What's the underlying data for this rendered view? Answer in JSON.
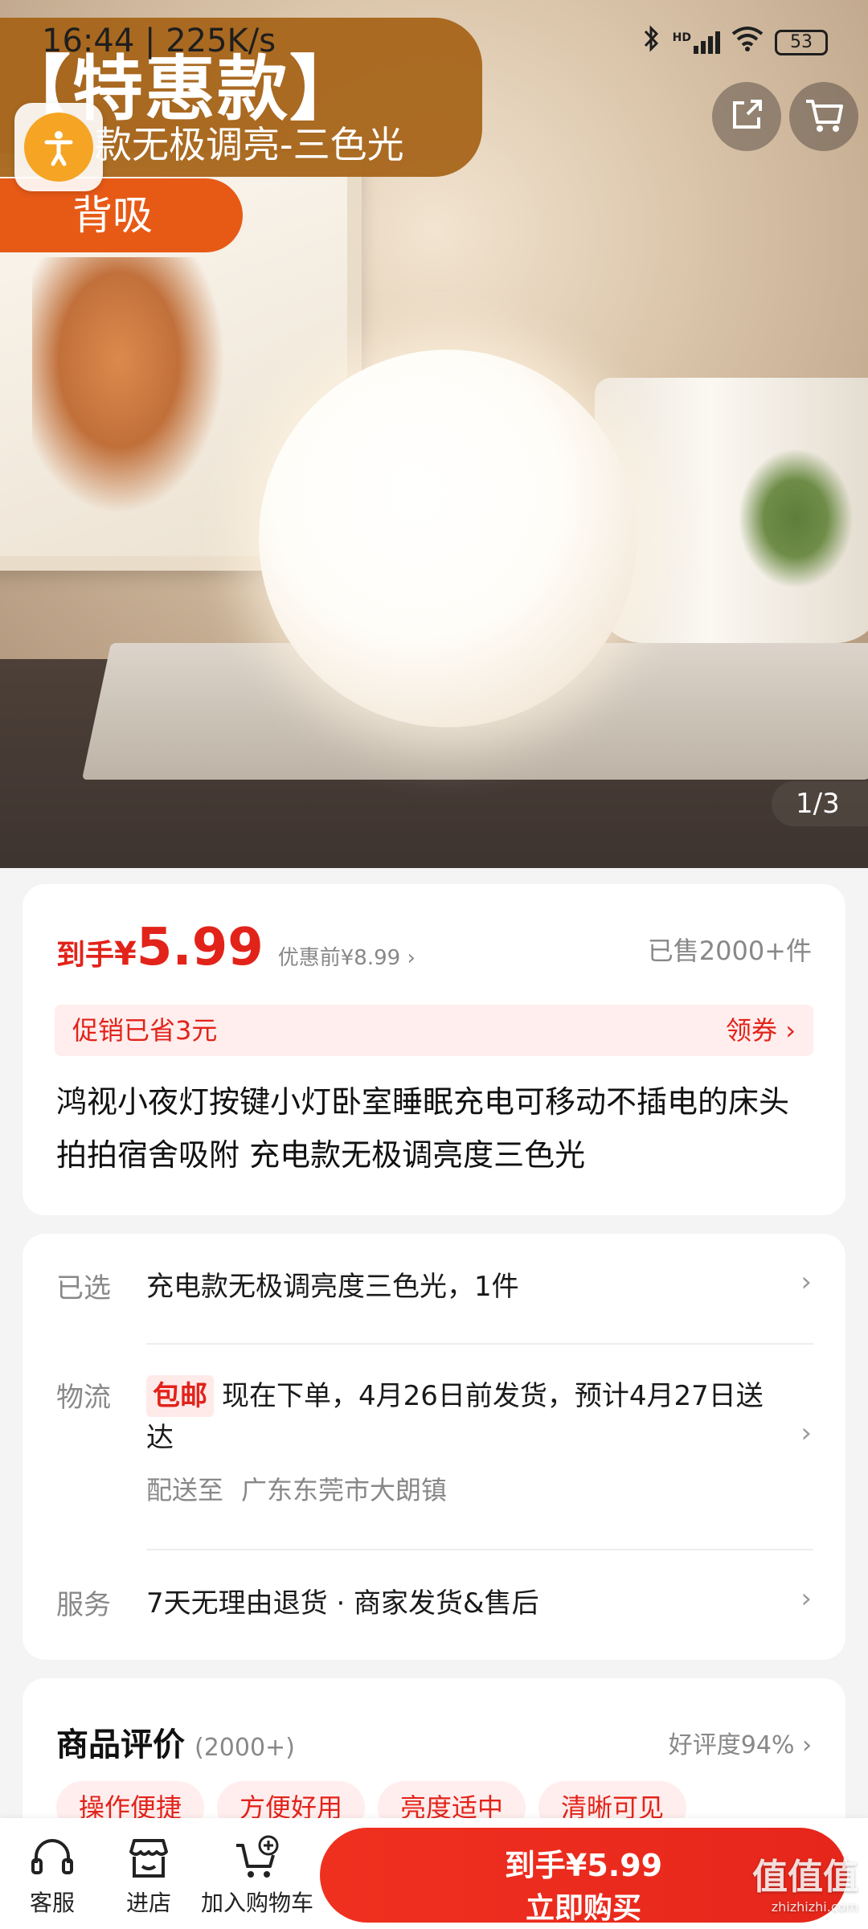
{
  "status_bar": {
    "time": "16:44",
    "speed": "225K/s",
    "network": "HD",
    "battery": "53"
  },
  "hero": {
    "promo_title": "【特惠款】",
    "promo_subtitle": "电款无极调亮-三色光",
    "promo_tag": "背吸",
    "image_counter": "1/3"
  },
  "price": {
    "label": "到手",
    "currency": "¥",
    "amount": "5.99",
    "original": "优惠前¥8.99 ›",
    "sold": "已售2000+件",
    "promo_text": "促销已省3元",
    "coupon_text": "领券 ›"
  },
  "product": {
    "title": "鸿视小夜灯按键小灯卧室睡眠充电可移动不插电的床头拍拍宿舍吸附 充电款无极调亮度三色光"
  },
  "info": {
    "selected_label": "已选",
    "selected_value": "充电款无极调亮度三色光，1件",
    "logistics_label": "物流",
    "free_shipping": "包邮",
    "logistics_value": "现在下单，4月26日前发货，预计4月27日送达",
    "ship_to_label": "配送至",
    "ship_to_value": "广东东莞市大朗镇",
    "service_label": "服务",
    "service_value": "7天无理由退货 · 商家发货&售后"
  },
  "reviews": {
    "title": "商品评价",
    "count": "(2000+)",
    "rating": "好评度94%",
    "tags": [
      "操作便捷",
      "方便好用",
      "亮度适中",
      "清晰可见"
    ]
  },
  "bottom_bar": {
    "service": "客服",
    "store": "进店",
    "cart": "加入购物车",
    "buy_price": "到手¥5.99",
    "buy_label": "立即购买"
  },
  "watermark": {
    "main": "值值值",
    "sub": "zhizhizhi.com"
  },
  "colors": {
    "accent": "#e2231a",
    "promo_brown": "#a56216",
    "promo_orange": "#e75a16",
    "float_orange": "#f5a523"
  }
}
